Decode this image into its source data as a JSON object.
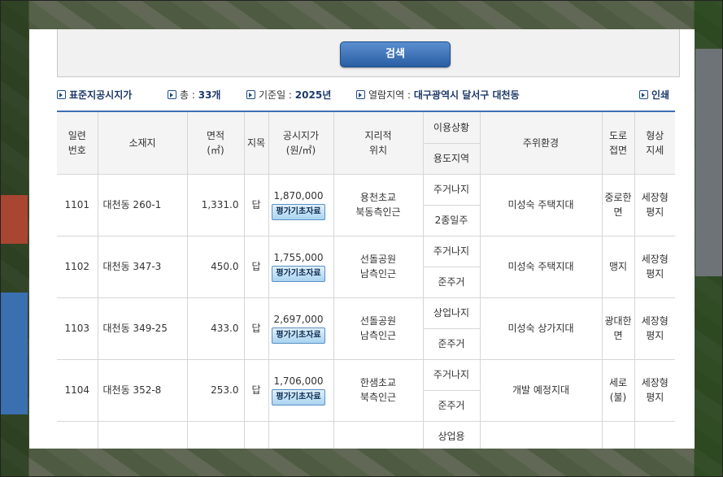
{
  "search": {
    "button_label": "검색"
  },
  "info": {
    "title": "표준지공시지가",
    "total_label": "총 : ",
    "total_value": "33개",
    "date_label": "기준일 : ",
    "date_value": "2025년",
    "region_label": "열람지역 : ",
    "region_value": "대구광역시 달서구 대천동",
    "print_label": "인쇄"
  },
  "table": {
    "headers": {
      "serial": "일련\n번호",
      "location": "소재지",
      "area": "면적\n(㎡)",
      "category": "지목",
      "price": "공시지가\n(원/㎡)",
      "geo": "지리적\n위치",
      "usage": "이용상황",
      "zone": "용도지역",
      "env": "주위환경",
      "road": "도로\n접면",
      "shape": "형상\n지세"
    },
    "eval_label": "평가기초자료",
    "rows": [
      {
        "no": "1101",
        "location": "대천동 260-1",
        "area": "1,331.0",
        "category": "답",
        "price": "1,870,000",
        "geo": "용천초교\n북동측인근",
        "usage": "주거나지",
        "zone": "2종일주",
        "env": "미성숙 주택지대",
        "road": "중로한\n면",
        "shape": "세장형\n평지"
      },
      {
        "no": "1102",
        "location": "대천동 347-3",
        "area": "450.0",
        "category": "답",
        "price": "1,755,000",
        "geo": "선돌공원\n남측인근",
        "usage": "주거나지",
        "zone": "준주거",
        "env": "미성숙 주택지대",
        "road": "맹지",
        "shape": "세장형\n평지"
      },
      {
        "no": "1103",
        "location": "대천동 349-25",
        "area": "433.0",
        "category": "답",
        "price": "2,697,000",
        "geo": "선돌공원\n남측인근",
        "usage": "상업나지",
        "zone": "준주거",
        "env": "미성숙 상가지대",
        "road": "광대한\n면",
        "shape": "세장형\n평지"
      },
      {
        "no": "1104",
        "location": "대천동 352-8",
        "area": "253.0",
        "category": "답",
        "price": "1,706,000",
        "geo": "한샘초교\n북측인근",
        "usage": "주거나지",
        "zone": "준주거",
        "env": "개발 예정지대",
        "road": "세로\n(불)",
        "shape": "세장형\n평지"
      },
      {
        "no": "",
        "location": "",
        "area": "",
        "category": "",
        "price": "",
        "geo": "",
        "usage": "상업용",
        "zone": "",
        "env": "",
        "road": "",
        "shape": ""
      }
    ]
  }
}
